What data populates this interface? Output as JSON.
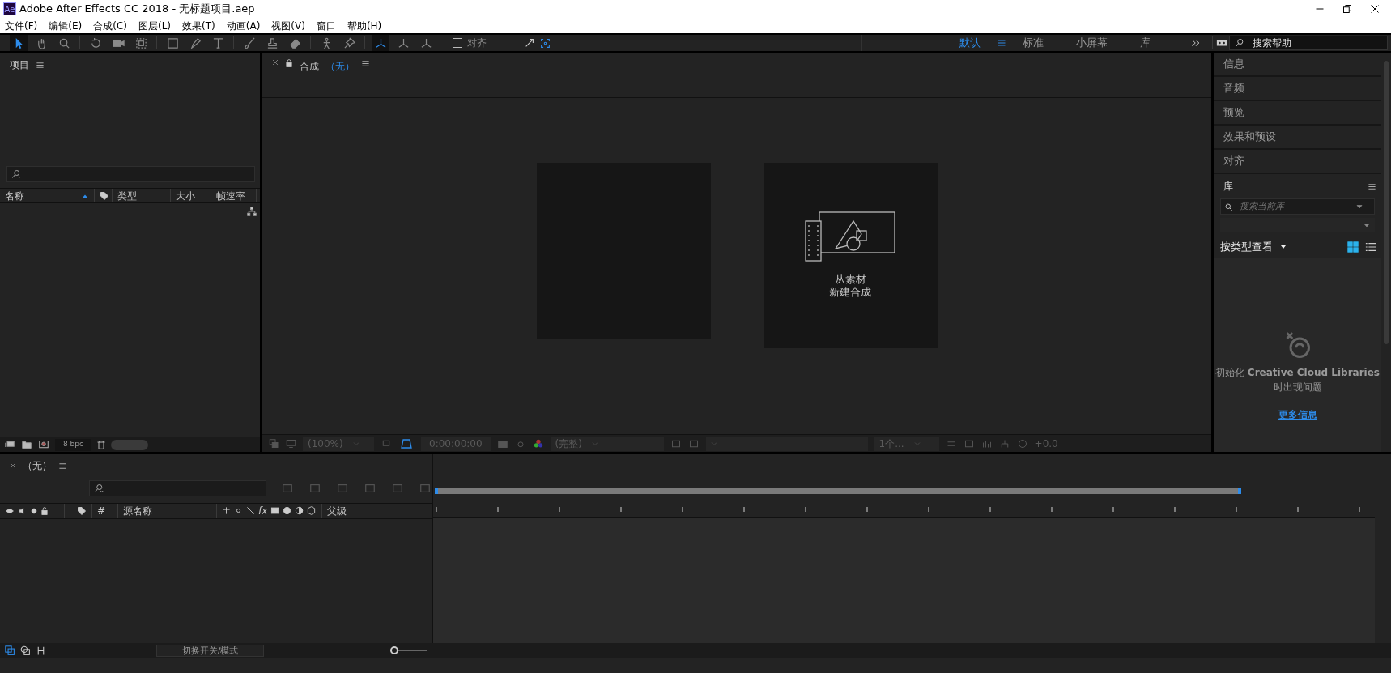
{
  "window": {
    "title": "Adobe After Effects CC 2018 - 无标题项目.aep",
    "app_badge": "Ae"
  },
  "menu": [
    "文件(F)",
    "编辑(E)",
    "合成(C)",
    "图层(L)",
    "效果(T)",
    "动画(A)",
    "视图(V)",
    "窗口",
    "帮助(H)"
  ],
  "toolbar": {
    "tools": [
      {
        "kind": "arrow",
        "selected": true
      },
      {
        "kind": "hand",
        "selected": false
      },
      {
        "kind": "zoom",
        "selected": false
      },
      {
        "kind": "rotate",
        "selected": false
      },
      {
        "kind": "camera",
        "selected": false
      },
      {
        "kind": "dashed",
        "selected": false
      },
      {
        "kind": "rect",
        "selected": false
      },
      {
        "kind": "pen",
        "selected": false
      },
      {
        "kind": "type",
        "selected": false
      },
      {
        "kind": "brush",
        "selected": false
      },
      {
        "kind": "stamp",
        "selected": false
      },
      {
        "kind": "eraser",
        "selected": false
      },
      {
        "kind": "puppet",
        "selected": false
      },
      {
        "kind": "pin",
        "selected": false
      },
      {
        "kind": "axis",
        "selected": true
      },
      {
        "kind": "axis",
        "selected": false
      },
      {
        "kind": "axis",
        "selected": false
      }
    ],
    "snap": {
      "label": "对齐",
      "checked": false
    },
    "workspaces": [
      {
        "label": "默认",
        "selected": true
      },
      {
        "label": "标准",
        "selected": false
      },
      {
        "label": "小屏幕",
        "selected": false
      },
      {
        "label": "库",
        "selected": false
      }
    ],
    "search_placeholder": "搜索帮助"
  },
  "project": {
    "title": "项目",
    "columns": [
      {
        "label": "名称",
        "sorted": true
      },
      {
        "label": "类型",
        "sorted": false
      },
      {
        "label": "大小",
        "sorted": false
      },
      {
        "label": "帧速率",
        "sorted": false
      }
    ],
    "bpc": "8 bpc"
  },
  "composition": {
    "tab": "合成",
    "tab_value": "（无）",
    "new_comp_lines": [
      "从素材",
      "新建合成"
    ],
    "footer": {
      "zoom": "(100%)",
      "timecode": "0:00:00:00",
      "resolution": "(完整)",
      "views": "1个...",
      "exposure": "+0.0"
    }
  },
  "side_panels": [
    "信息",
    "音频",
    "预览",
    "效果和预设",
    "对齐"
  ],
  "library": {
    "title": "库",
    "search_placeholder": "搜索当前库",
    "view_by": "按类型查看",
    "view_modes": [
      {
        "kind": "grid",
        "selected": true
      },
      {
        "kind": "list",
        "selected": false
      }
    ],
    "message": "初始化 **Creative Cloud Libraries** 时出现问题",
    "link": "更多信息"
  },
  "timeline": {
    "tab": "（无）",
    "columns": [
      "#",
      "源名称",
      "fx",
      "父级"
    ],
    "toggle_button": "切换开关/模式",
    "zoom_slider": {
      "level": 0.1
    },
    "footer_toggles": [
      {
        "kind": "comp",
        "selected": true
      },
      {
        "kind": "blend",
        "selected": false
      },
      {
        "kind": "stretch",
        "selected": false
      }
    ]
  }
}
